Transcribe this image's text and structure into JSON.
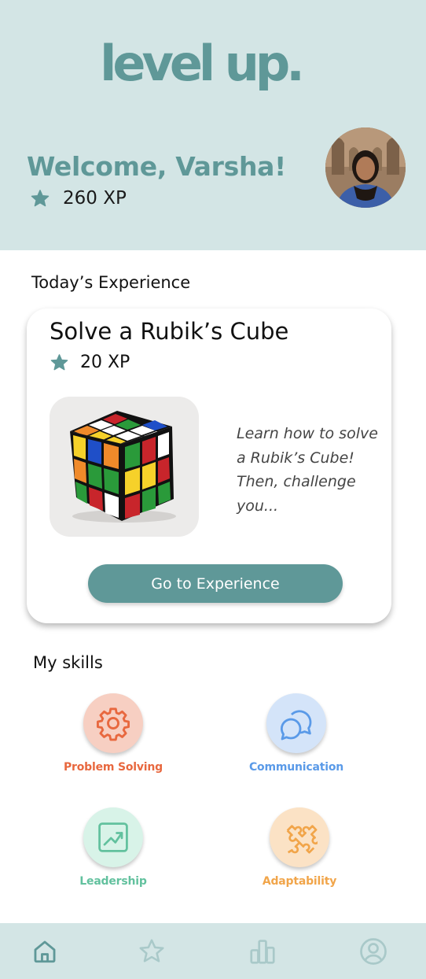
{
  "header": {
    "logo": "level up.",
    "welcome": "Welcome, Varsha!",
    "xp": "260 XP"
  },
  "today": {
    "section_title": "Today’s Experience",
    "title": "Solve a Rubik’s Cube",
    "xp": "20 XP",
    "description": "Learn how to solve a Rubik’s Cube! Then, challenge you...",
    "button": "Go to Experience"
  },
  "skills": {
    "section_title": "My skills",
    "items": [
      {
        "label": "Problem Solving",
        "icon": "gear-icon",
        "color": "#e8683f",
        "bg": "#f7cfc2"
      },
      {
        "label": "Communication",
        "icon": "chat-bubbles-icon",
        "color": "#5a9ae8",
        "bg": "#d4e4f9"
      },
      {
        "label": "Leadership",
        "icon": "trending-up-chart-icon",
        "color": "#62c19e",
        "bg": "#d8f3e8"
      },
      {
        "label": "Adaptability",
        "icon": "puzzle-piece-icon",
        "color": "#f1a54a",
        "bg": "#fbe2c5"
      }
    ]
  },
  "nav": {
    "items": [
      {
        "icon": "home-icon",
        "active": true
      },
      {
        "icon": "star-icon",
        "active": false
      },
      {
        "icon": "bar-chart-icon",
        "active": false
      },
      {
        "icon": "profile-icon",
        "active": false
      }
    ]
  },
  "colors": {
    "accent": "#5f9898",
    "header_bg": "#d3e5e5",
    "star": "#5f9898"
  }
}
